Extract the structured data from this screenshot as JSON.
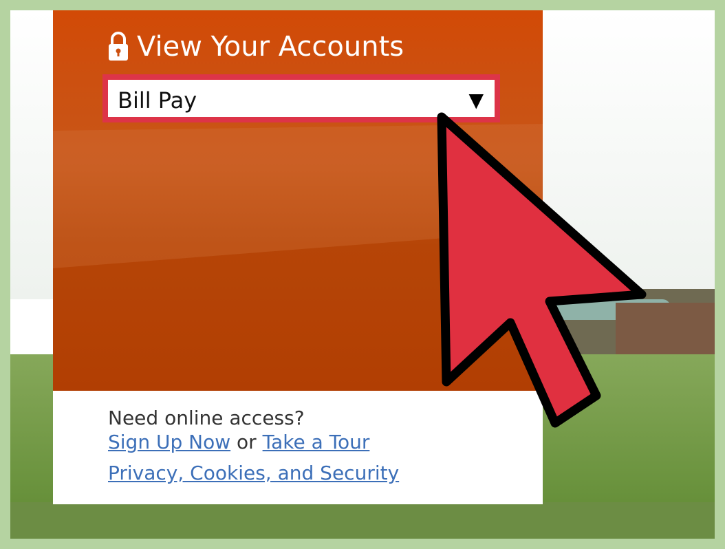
{
  "panel": {
    "title": "View Your Accounts",
    "lock_icon": "lock-icon",
    "select": {
      "value": "Bill Pay",
      "arrow": "▼"
    }
  },
  "access": {
    "prompt": "Need online access?",
    "sign_up_link": "Sign Up Now",
    "or_text": "or",
    "tour_link": "Take a Tour",
    "privacy_link": "Privacy, Cookies, and Security"
  },
  "colors": {
    "panel_orange": "#c85618",
    "highlight_red": "#dd3448",
    "link_blue": "#3c6fb8",
    "cursor_red": "#e03040",
    "frame_green": "#b5d3a1"
  },
  "cursor_icon": "mouse-pointer-icon"
}
